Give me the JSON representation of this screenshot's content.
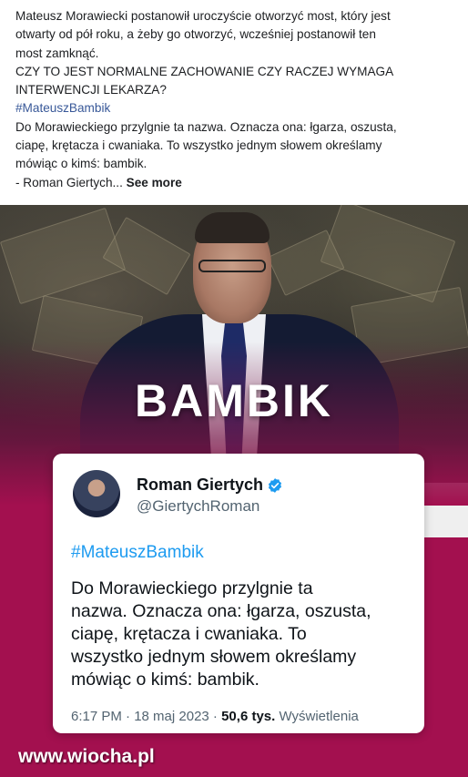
{
  "post": {
    "line1": "Mateusz Morawiecki postanowił uroczyście otworzyć most, który jest",
    "line2": "otwarty od pół roku, a żeby go otworzyć, wcześniej postanowił ten",
    "line3": "most zamknąć.",
    "line4": "CZY TO JEST NORMALNE ZACHOWANIE CZY RACZEJ WYMAGA",
    "line5": "INTERWENCJI LEKARZA?",
    "hashtag": "#MateuszBambik",
    "line6": "Do Morawieckiego przylgnie ta nazwa. Oznacza ona: łgarza, oszusta,",
    "line7": "ciapę, krętacza i cwaniaka. To wszystko jednym słowem określamy",
    "line8": "mówiąc o kimś: bambik.",
    "line9": "- Roman Giertych...",
    "see_more": "See more"
  },
  "image": {
    "headline": "BAMBIK",
    "headline_color": "#ffffff",
    "background_color": "#a3104f",
    "watermark": "www.wiocha.pl"
  },
  "tweet": {
    "name": "Roman Giertych",
    "handle": "@GiertychRoman",
    "verified_icon": "verified-badge-icon",
    "hashtag": "#MateuszBambik",
    "body_lines": [
      "Do Morawieckiego przylgnie ta",
      "nazwa. Oznacza ona: łgarza, oszusta,",
      "ciapę, krętacza i cwaniaka. To",
      "wszystko jednym słowem określamy",
      "mówiąc o kimś: bambik."
    ],
    "time": "6:17 PM · 18 maj 2023 · ",
    "views_count": "50,6 tys.",
    "views_label": " Wyświetlenia",
    "accent_color": "#1d9bf0"
  }
}
